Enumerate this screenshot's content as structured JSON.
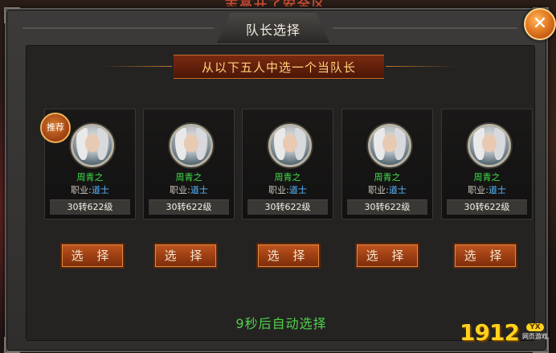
{
  "background_banner_text": "志高开了安全区",
  "dialog": {
    "title": "队长选择",
    "instruction": "从以下五人中选一个当队长",
    "recommend_badge": "推荐",
    "close_icon": "close-icon",
    "countdown": "9秒后自动选择",
    "select_label": "选 择"
  },
  "candidates": [
    {
      "name": "周青之",
      "class_label": "职业:",
      "class_value": "道士",
      "level": "30转622级"
    },
    {
      "name": "周青之",
      "class_label": "职业:",
      "class_value": "道士",
      "level": "30转622级"
    },
    {
      "name": "周青之",
      "class_label": "职业:",
      "class_value": "道士",
      "level": "30转622级"
    },
    {
      "name": "周青之",
      "class_label": "职业:",
      "class_value": "道士",
      "level": "30转622级"
    },
    {
      "name": "周青之",
      "class_label": "职业:",
      "class_value": "道士",
      "level": "30转622级"
    }
  ],
  "watermark": {
    "number": "1912",
    "badge": "YX",
    "sub": "网页游戏"
  },
  "colors": {
    "name": "#3fe04a",
    "class_value": "#58b8ff",
    "countdown": "#4fd24b",
    "banner_text": "#ffd27a"
  }
}
